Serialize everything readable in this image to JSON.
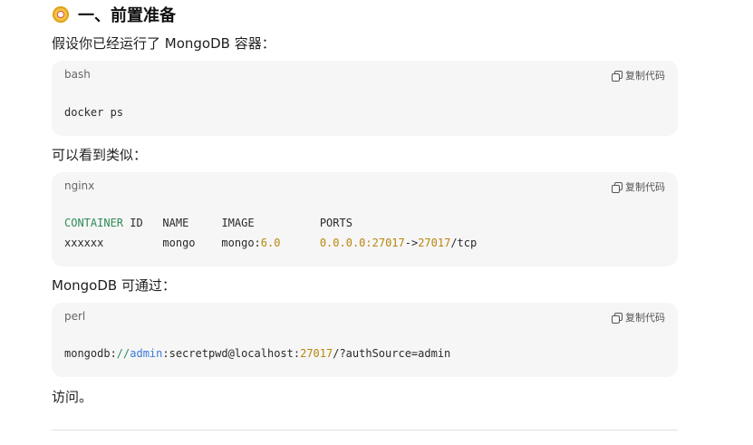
{
  "heading": {
    "text": "一、前置准备",
    "icon": "compass-emoji-icon"
  },
  "intro": "假设你已经运行了 MongoDB 容器：",
  "block1": {
    "lang": "bash",
    "copy_label": "复制代码",
    "code": "docker ps"
  },
  "similar": "可以看到类似：",
  "block2": {
    "lang": "nginx",
    "copy_label": "复制代码",
    "header": {
      "container": "CONTAINER",
      "id": " ID",
      "name": "NAME",
      "image": "IMAGE",
      "ports": "PORTS"
    },
    "row": {
      "id": "xxxxxx",
      "name": "mongo",
      "image_name": "mongo:",
      "image_version": "6.0",
      "port_host": "0.0.0.0:27017",
      "arrow": "->",
      "port_container": "27017",
      "proto": "/tcp"
    }
  },
  "via": "MongoDB 可通过：",
  "block3": {
    "lang": "perl",
    "copy_label": "复制代码",
    "scheme": "mongodb:",
    "slashes": "//",
    "user": "admin",
    "rest": ":secretpwd@localhost:",
    "port": "27017",
    "tail": "/?authSource=admin"
  },
  "access": "访问。"
}
